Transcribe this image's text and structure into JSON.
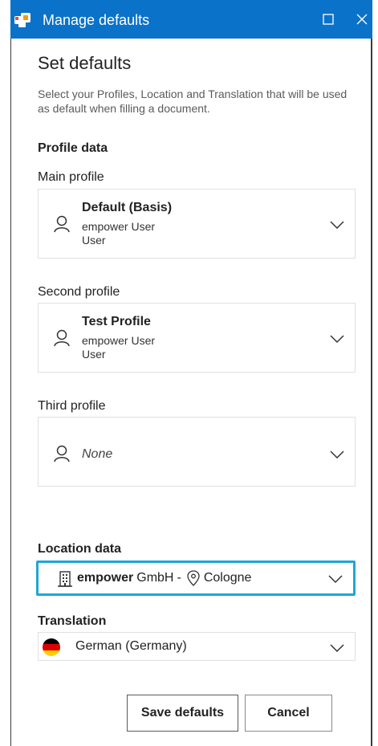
{
  "window": {
    "title": "Manage defaults",
    "icons": {
      "app": "defaults-app-icon",
      "maximize": "maximize-icon",
      "close": "close-icon"
    }
  },
  "main": {
    "heading": "Set defaults",
    "description": "Select your Profiles, Location and Translation that will be used as default when filling a document."
  },
  "profile_data": {
    "section_title": "Profile data",
    "main": {
      "label": "Main profile",
      "name": "Default (Basis)",
      "line1": "empower User",
      "line2": "User"
    },
    "second": {
      "label": "Second profile",
      "name": "Test Profile",
      "line1": "empower User",
      "line2": "User"
    },
    "third": {
      "label": "Third profile",
      "value": "None"
    }
  },
  "location_data": {
    "section_title": "Location data",
    "company_bold": "empower",
    "company_rest": "GmbH",
    "separator": "-",
    "city": "Cologne",
    "highlight_color": "#1fa6d6"
  },
  "translation": {
    "label": "Translation",
    "value": "German (Germany)",
    "flag_colors": [
      "#000000",
      "#dd0000",
      "#ffce00"
    ]
  },
  "actions": {
    "save_label": "Save defaults",
    "cancel_label": "Cancel"
  },
  "colors": {
    "titlebar": "#0b72c9",
    "accent": "#1fa6d6"
  }
}
